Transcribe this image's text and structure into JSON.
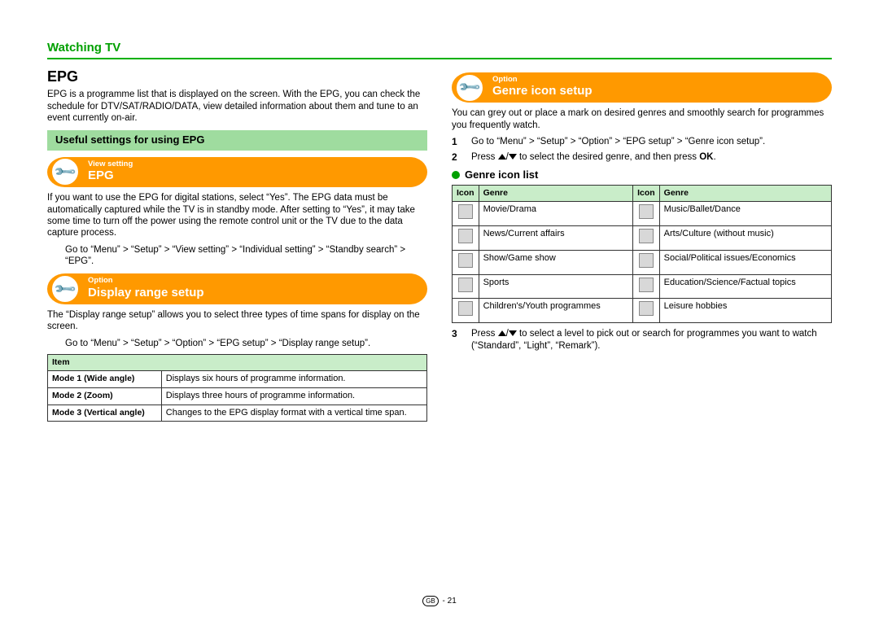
{
  "header": {
    "section": "Watching TV"
  },
  "col1": {
    "title": "EPG",
    "intro": "EPG is a programme list that is displayed on the screen. With the EPG, you can check the schedule for DTV/SAT/RADIO/DATA, view detailed information about them and tune to an event currently on-air.",
    "greenbar": "Useful settings for using EPG",
    "pill1_small": "View setting",
    "pill1_title": "EPG",
    "epg_desc": "If you want to use the EPG for digital stations, select “Yes”. The EPG data must be automatically captured while the TV is in standby mode. After setting to “Yes”, it may take some time to turn off the power using the remote control unit or the TV due to the data capture process.",
    "epg_path": "Go to “Menu” > “Setup” > “View setting” > “Individual setting” > “Standby search” > “EPG”.",
    "pill2_small": "Option",
    "pill2_title": "Display range setup",
    "drs_desc": "The “Display range setup” allows you to select three types of time spans for display on the screen.",
    "drs_path": "Go to “Menu” > “Setup” > “Option” > “EPG setup” > “Display range setup”.",
    "table": {
      "head": "Item",
      "rows": [
        {
          "mode": "Mode 1 (Wide angle)",
          "desc": "Displays six hours of programme information."
        },
        {
          "mode": "Mode 2 (Zoom)",
          "desc": "Displays three hours of programme information."
        },
        {
          "mode": "Mode 3 (Vertical angle)",
          "desc": "Changes to the EPG display format with a vertical time span."
        }
      ]
    }
  },
  "col2": {
    "pill_small": "Option",
    "pill_title": "Genre icon setup",
    "intro": "You can grey out or place a mark on desired genres and smoothly search for programmes you frequently watch.",
    "step1": "Go to “Menu” > “Setup” > “Option” > “EPG setup” > “Genre icon setup”.",
    "step2a": "Press ",
    "step2b": " to select the desired genre, and then press ",
    "step2c": "OK",
    "step2d": ".",
    "subhead": "Genre icon list",
    "table": {
      "h1": "Icon",
      "h2": "Genre",
      "h3": "Icon",
      "h4": "Genre",
      "rows": [
        {
          "g1": "Movie/Drama",
          "g2": "Music/Ballet/Dance"
        },
        {
          "g1": "News/Current affairs",
          "g2": "Arts/Culture (without music)"
        },
        {
          "g1": "Show/Game show",
          "g2": "Social/Political issues/Economics"
        },
        {
          "g1": "Sports",
          "g2": "Education/Science/Factual topics"
        },
        {
          "g1": "Children's/Youth programmes",
          "g2": "Leisure hobbies"
        }
      ]
    },
    "step3a": "Press ",
    "step3b": " to select a level to pick out or search for programmes you want to watch (“Standard”, “Light”, “Remark”)."
  },
  "footer": {
    "gb": "GB",
    "page": "21"
  }
}
